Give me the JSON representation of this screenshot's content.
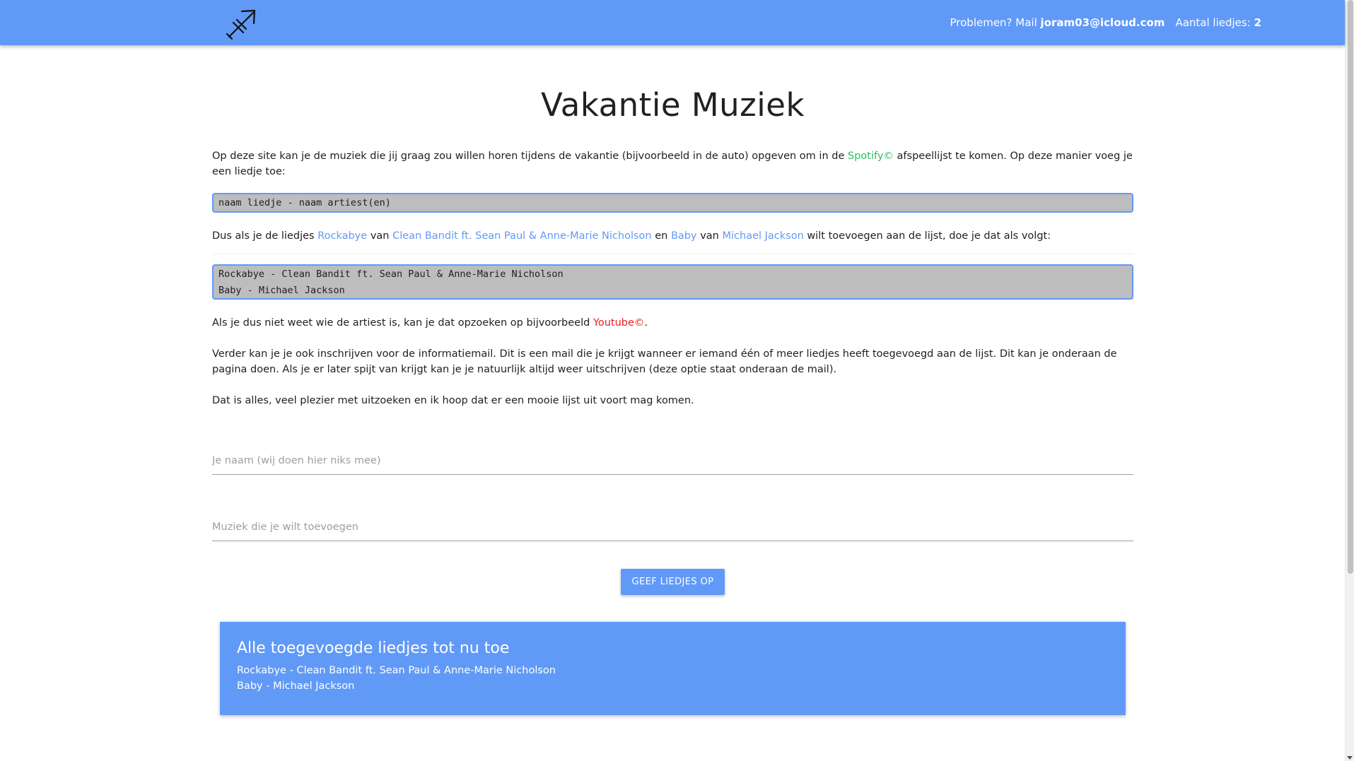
{
  "colors": {
    "primary": "#6199f7",
    "spotify": "#2bbd5b",
    "youtube": "#ee1c1c",
    "code_bg": "#bdbdbd"
  },
  "navbar": {
    "logo_icon": "sagittarius-arrow-icon",
    "problems_prefix": "Problemen? Mail",
    "email": "joram03@icloud.com",
    "song_count_label": "Aantal liedjes:",
    "song_count": "2"
  },
  "main": {
    "title": "Vakantie Muziek",
    "intro": {
      "before": "Op deze site kan je de muziek die jij graag zou willen horen tijdens de vakantie (bijvoorbeeld in de auto) opgeven om in de",
      "spotify": "Spotify©",
      "after": "afspeellijst te komen. Op deze manier voeg je een liedje toe:"
    },
    "format_example": "naam liedje - naam artiest(en)",
    "example_sentence": {
      "part1": "Dus als je de liedjes",
      "song1": "Rockabye",
      "van1": "van",
      "artist1": "Clean Bandit ft. Sean Paul & Anne-Marie Nicholson",
      "en": "en",
      "song2": "Baby",
      "van2": "van",
      "artist2": "Michael Jackson",
      "part2": "wilt toevoegen aan de lijst, doe je dat als volgt:"
    },
    "example_lines": [
      "Rockabye - Clean Bandit ft. Sean Paul & Anne-Marie Nicholson",
      "Baby - Michael Jackson"
    ],
    "youtube_sentence": {
      "before": "Als je dus niet weet wie de artiest is, kan je dat opzoeken op bijvoorbeeld",
      "youtube": "Youtube©",
      "after": "."
    },
    "newsletter_text": "Verder kan je je ook inschrijven voor de informatiemail. Dit is een mail die je krijgt wanneer er iemand één of meer liedjes heeft toegevoegd aan de lijst. Dit kan je onderaan de pagina doen. Als je er later spijt van krijgt kan je je natuurlijk altijd weer uitschrijven (deze optie staat onderaan de mail).",
    "closing_text": "Dat is alles, veel plezier met uitzoeken en ik hoop dat er een mooie lijst uit voort mag komen."
  },
  "form": {
    "name_placeholder": "Je naam (wij doen hier niks mee)",
    "name_value": "",
    "music_placeholder": "Muziek die je wilt toevoegen",
    "music_value": "",
    "submit_label": "Geef liedjes op"
  },
  "songs_card": {
    "title": "Alle toegevoegde liedjes tot nu toe",
    "items": [
      "Rockabye - Clean Bandit ft. Sean Paul & Anne-Marie Nicholson",
      "Baby - Michael Jackson"
    ]
  }
}
